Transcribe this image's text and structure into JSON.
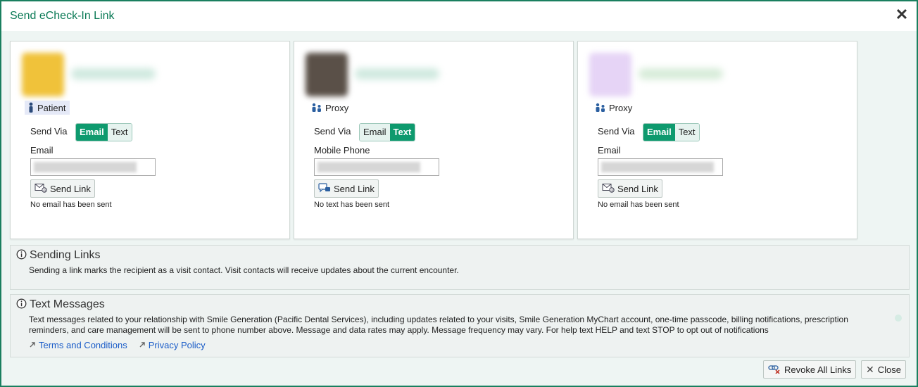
{
  "dialog": {
    "title": "Send eCheck-In Link",
    "close_icon": "close-icon"
  },
  "cards": [
    {
      "role": "Patient",
      "role_icon": "person-icon",
      "send_via_label": "Send Via",
      "options": [
        "Email",
        "Text"
      ],
      "selected": "Email",
      "field_label": "Email",
      "send_label": "Send Link",
      "send_icon": "email-send-icon",
      "status": "No email has been sent",
      "avatar_color": "#f0c23a"
    },
    {
      "role": "Proxy",
      "role_icon": "proxy-people-icon",
      "send_via_label": "Send Via",
      "options": [
        "Email",
        "Text"
      ],
      "selected": "Text",
      "field_label": "Mobile Phone",
      "send_label": "Send Link",
      "send_icon": "text-message-icon",
      "status": "No text has been sent",
      "avatar_color": "#5a5048"
    },
    {
      "role": "Proxy",
      "role_icon": "proxy-people-icon",
      "send_via_label": "Send Via",
      "options": [
        "Email",
        "Text"
      ],
      "selected": "Email",
      "field_label": "Email",
      "send_label": "Send Link",
      "send_icon": "email-send-icon",
      "status": "No email has been sent",
      "avatar_color": "#d9c2f0"
    }
  ],
  "sending_links": {
    "title": "Sending Links",
    "text": "Sending a link marks the recipient as a visit contact. Visit contacts will receive updates about the current encounter."
  },
  "text_messages": {
    "title": "Text Messages",
    "text": "Text messages related to your relationship with Smile Generation (Pacific Dental Services), including updates related to your visits, Smile Generation MyChart account, one-time passcode, billing notifications, prescription reminders, and care management will be sent to phone number above. Message and data rates may apply. Message frequency may vary. For help text HELP and text STOP to opt out of notifications",
    "links": [
      "Terms and Conditions",
      "Privacy Policy"
    ]
  },
  "footer": {
    "revoke_label": "Revoke All Links",
    "close_label": "Close"
  },
  "colors": {
    "accent": "#0e9a6e",
    "title": "#0b7a56",
    "link": "#1a5cc8",
    "border": "#1a7f5f"
  }
}
